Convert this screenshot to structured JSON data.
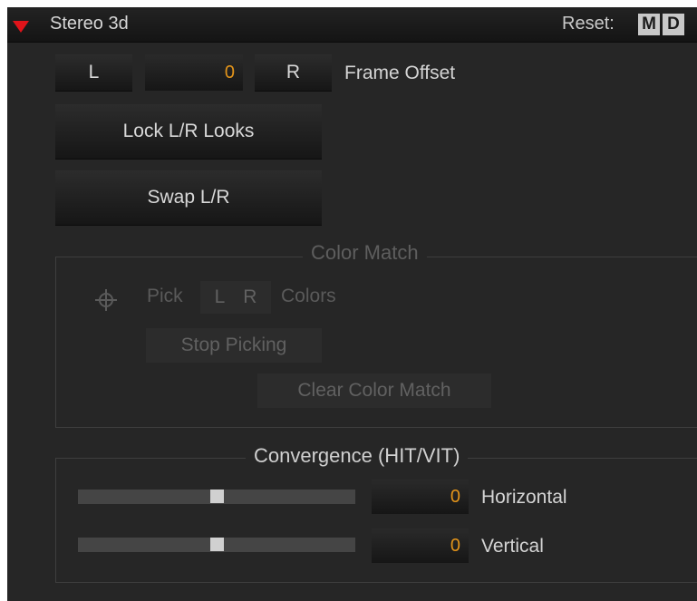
{
  "header": {
    "title": "Stereo 3d",
    "reset_label": "Reset:",
    "reset_m": "M",
    "reset_d": "D"
  },
  "frame_offset": {
    "left_button": "L",
    "value": "0",
    "right_button": "R",
    "label": "Frame Offset"
  },
  "buttons": {
    "lock_lr_looks": "Lock L/R Looks",
    "swap_lr": "Swap L/R"
  },
  "color_match": {
    "title": "Color Match",
    "pick_label": "Pick",
    "pick_l": "L",
    "pick_r": "R",
    "colors_label": "Colors",
    "stop_picking": "Stop Picking",
    "clear_color_match": "Clear Color Match",
    "enabled": false
  },
  "convergence": {
    "title": "Convergence (HIT/VIT)",
    "horizontal": {
      "value": "0",
      "label": "Horizontal",
      "slider_fraction": 0.5
    },
    "vertical": {
      "value": "0",
      "label": "Vertical",
      "slider_fraction": 0.5
    }
  },
  "colors": {
    "accent_value": "#e3941a",
    "collapse_triangle": "#e0141a",
    "panel_background": "#262626"
  }
}
